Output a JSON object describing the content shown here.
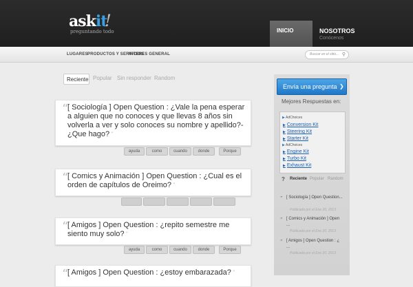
{
  "header": {
    "logo_main": "ask",
    "logo_accent": "it",
    "logo_bang": "!",
    "tagline": "preguntando todo",
    "nav": [
      {
        "label": "INICIO"
      },
      {
        "label": "NOSOTROS",
        "sublabel": "Conócenos"
      }
    ]
  },
  "subnav": {
    "items": [
      "LUGARES",
      "PRODUCTOS Y SERVICIOS",
      "INTERES GENERAL"
    ],
    "search_placeholder": "Buscar en el sitio..."
  },
  "tabs": [
    "Reciente",
    "Popular",
    "Sin responder",
    "Random"
  ],
  "questions": [
    {
      "title": "[ Sociología ] Open Question : ¿Vale la pena esperar a alguien que no conoces y que llevas 8 años sin volverla a ver y solo conoces su nombre y apellido?- ¿Que hago?",
      "tags": [
        "ayuda",
        "como",
        "cuando",
        "donde",
        "Porque"
      ]
    },
    {
      "title": "[ Comics y Animación ] Open Question : ¿Cual es el orden de capítulos de Oreimo?",
      "tags": [
        "",
        "",
        "",
        "",
        ""
      ]
    },
    {
      "title": "[ Amigos ] Open Question : ¿repito semestre me siento muy solo?",
      "tags": [
        "ayuda",
        "como",
        "cuando",
        "donde",
        "Porque"
      ]
    },
    {
      "title": "[ Amigos ] Open Question : ¿estoy embarazada?",
      "tags": []
    }
  ],
  "sidebar": {
    "ask_button": "Envía una pregunta",
    "ask_arrow": "❯",
    "heading": "Mejores Respuestas en:",
    "adchoices_label": "AdChoices",
    "ad_group1": [
      "Conversion Kit",
      "Steering Kit",
      "Starter Kit"
    ],
    "ad_group2": [
      "Engine Kit",
      "Turbo Kit",
      "Exhaust Kit"
    ],
    "tab_icon": "?",
    "tabs": [
      "Reciente",
      "Popular",
      "Random"
    ],
    "recent": [
      {
        "title": "[ Sociología ] Open Question...",
        "date": "Publicada por el Ene 20, 2013"
      },
      {
        "title": "[ Comics y Animación ] Open ...",
        "date": "Publicada por el Ene 20, 2013"
      },
      {
        "title": "[ Amigos ] Open Question : ¿ ...",
        "date": "Publicada por el Ene 20, 2013"
      }
    ]
  },
  "icons": {
    "quote": "quote-icon",
    "search": "search-icon",
    "arrow": "arrow-right-icon"
  }
}
